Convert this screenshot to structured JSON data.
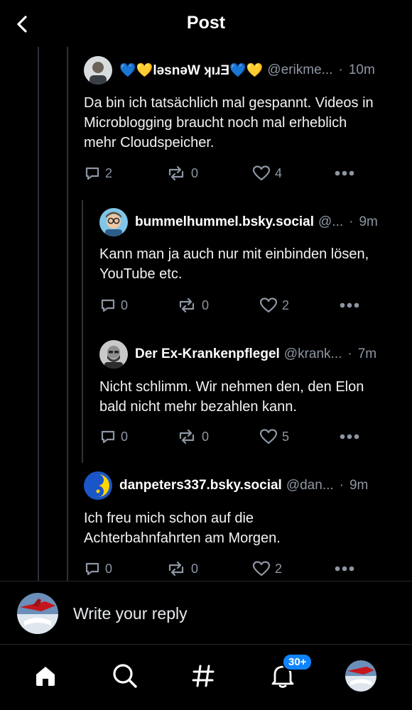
{
  "header": {
    "title": "Post"
  },
  "posts": [
    {
      "display_name": "💙💛ləsnəW ʞıɹƎ💙💛",
      "handle": "@erikme...",
      "time": "10m",
      "text": "Da bin ich tatsächlich mal gespannt. Videos in Microblogging braucht noch mal erheblich mehr Cloudspeicher.",
      "replies": "2",
      "reposts": "0",
      "likes": "4"
    },
    {
      "display_name": "bummelhummel.bsky.social",
      "handle": "@...",
      "time": "9m",
      "text": "Kann man ja auch nur mit einbinden lösen, YouTube etc.",
      "replies": "0",
      "reposts": "0",
      "likes": "2"
    },
    {
      "display_name": "Der Ex-Krankenpflegel",
      "handle": "@krank...",
      "time": "7m",
      "text": "Nicht schlimm. Wir nehmen den, den Elon bald nicht mehr bezahlen kann.",
      "replies": "0",
      "reposts": "0",
      "likes": "5"
    },
    {
      "display_name": "danpeters337.bsky.social",
      "handle": "@dan...",
      "time": "9m",
      "text": "Ich freu mich schon auf die Achterbahnfahrten am Morgen.",
      "replies": "0",
      "reposts": "0",
      "likes": "2"
    }
  ],
  "reply_bar": {
    "placeholder": "Write your reply"
  },
  "bottom_nav": {
    "items": [
      "home-icon",
      "search-icon",
      "feeds-hash-icon",
      "notifications-bell-icon",
      "profile-avatar"
    ],
    "notifications_badge": "30+"
  },
  "colors": {
    "accent": "#1083fe",
    "background": "#000000",
    "muted": "#8d96a3"
  }
}
